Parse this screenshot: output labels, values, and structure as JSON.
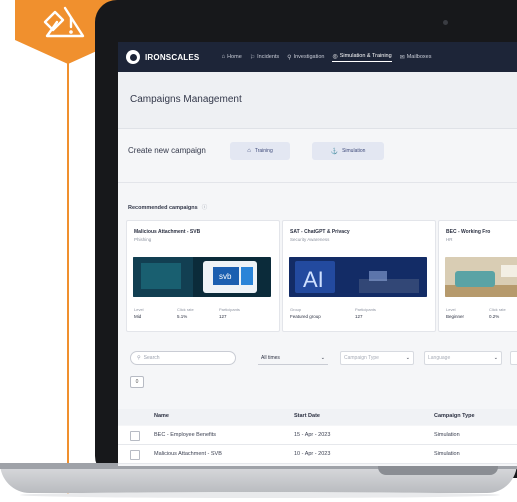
{
  "nav": {
    "brand": "IRONSCALES",
    "items": [
      {
        "icon": "home-icon",
        "glyph": "⌂",
        "label": "Home"
      },
      {
        "icon": "incidents-icon",
        "glyph": "⚐",
        "label": "Incidents"
      },
      {
        "icon": "investigation-icon",
        "glyph": "⚲",
        "label": "Investigation"
      },
      {
        "icon": "simulation-icon",
        "glyph": "◎",
        "label": "Simulation & Training"
      },
      {
        "icon": "mailbox-icon",
        "glyph": "✉",
        "label": "Mailboxes"
      }
    ]
  },
  "page": {
    "title": "Campaigns Management"
  },
  "create": {
    "label": "Create new campaign",
    "training_label": "Training",
    "simulation_label": "Simulation"
  },
  "recommended": {
    "label": "Recommended campaigns",
    "cards": [
      {
        "title": "Malicious Attachment - SVB",
        "subtitle": "Phishing",
        "m1_label": "Level",
        "m1_value": "Mid",
        "m2_label": "Click rate",
        "m2_value": "5.1%",
        "m3_label": "Participants",
        "m3_value": "127"
      },
      {
        "title": "SAT - ChatGPT & Privacy",
        "subtitle": "Security Awareness",
        "m1_label": "Group",
        "m1_value": "Featured group",
        "m3_label": "Participants",
        "m3_value": "127"
      },
      {
        "title": "BEC - Working Fro",
        "subtitle": "HR",
        "m1_label": "Level",
        "m1_value": "Beginner",
        "m2_label": "Click rate",
        "m2_value": "0.2%"
      }
    ]
  },
  "filters": {
    "search_placeholder": "Search",
    "time": "All times",
    "campaign_type": "Campaign Type",
    "language": "Language",
    "select_count": "0"
  },
  "table": {
    "headers": {
      "name": "Name",
      "start_date": "Start Date",
      "type": "Campaign Type"
    },
    "rows": [
      {
        "name": "BEC - Employee Benefits",
        "date": "15 - Apr - 2023",
        "type": "Simulation"
      },
      {
        "name": "Malicious Attachment - SVB",
        "date": "10 - Apr - 2023",
        "type": "Simulation"
      }
    ]
  },
  "colors": {
    "badge": "#f0902e",
    "nav": "#1d2538",
    "accent": "#3e4a7a"
  }
}
